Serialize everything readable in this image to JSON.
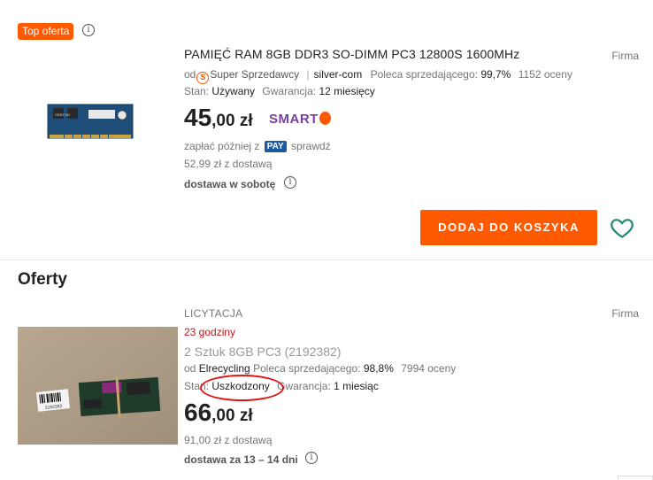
{
  "top_badge": "Top oferta",
  "info_glyph": "i",
  "offer1": {
    "seller_type": "Firma",
    "title": "PAMIĘĆ RAM 8GB DDR3 SO-DIMM PC3 12800S 1600MHz",
    "od_label": "od",
    "super_label": "Super Sprzedawcy",
    "super_glyph": "S",
    "separator": "|",
    "seller": "silver-com",
    "recommend_label": "Poleca sprzedającego:",
    "recommend_value": "99,7%",
    "ratings": "1152 oceny",
    "condition_label": "Stan:",
    "condition_value": "Używany",
    "warranty_label": "Gwarancja:",
    "warranty_value": "12 miesięcy",
    "price_main": "45",
    "price_rest": ",00 zł",
    "smart_label": "SMART",
    "pay_later_prefix": "zapłać później z",
    "pay_badge": "PAY",
    "pay_later_suffix": "sprawdź",
    "with_delivery": "52,99 zł z dostawą",
    "delivery": "dostawa w sobotę",
    "add_to_cart": "DODAJ DO KOSZYKA"
  },
  "section_title": "Oferty",
  "offer2": {
    "seller_type": "Firma",
    "type": "LICYTACJA",
    "timer": "23 godziny",
    "title": "2 Sztuk 8GB PC3 (2192382)",
    "od_label": "od",
    "seller": "Elrecycling",
    "recommend_label": "Poleca sprzedającego:",
    "recommend_value": "98,8%",
    "ratings": "7994 oceny",
    "condition_label": "Stan:",
    "condition_value": "Uszkodzony",
    "warranty_label": "Gwarancja:",
    "warranty_value": "1 miesiąc",
    "price_main": "66",
    "price_rest": ",00 zł",
    "with_delivery": "91,00 zł z dostawą",
    "delivery": "dostawa za 13 – 14 dni"
  },
  "images": {
    "photo1_label": "CENTON",
    "photo2_barcode_label": "2192382"
  },
  "icons": {
    "info": "info-icon",
    "heart": "heart-icon",
    "super_seller": "super-seller-icon"
  },
  "colors": {
    "accent": "#ff5a00",
    "smart": "#7b3fa0",
    "timer": "#c0151d",
    "pay": "#1e5aa0",
    "annotation": "#e01414",
    "heart": "#2a8a7a"
  }
}
